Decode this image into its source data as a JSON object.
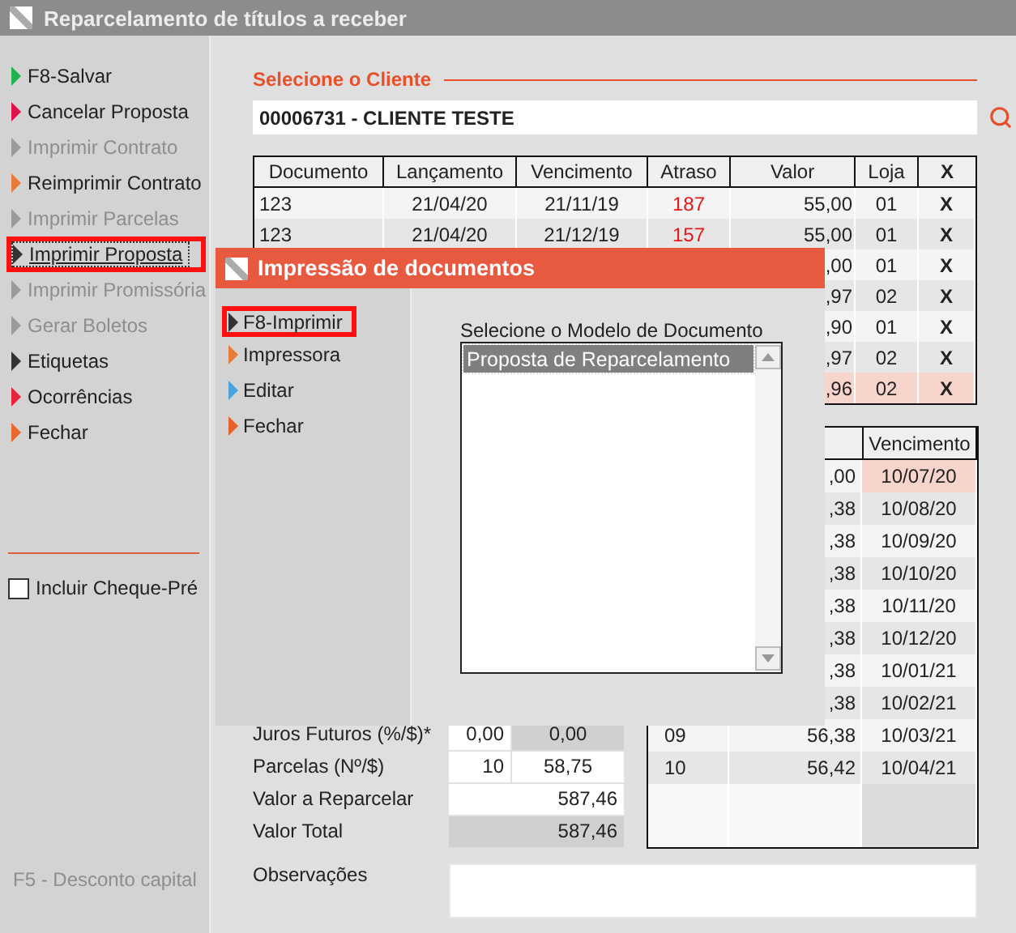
{
  "window": {
    "title": "Reparcelamento de títulos a receber"
  },
  "sidebar": {
    "items": [
      {
        "label": "F8-Salvar",
        "color": "#22b14c",
        "disabled": false,
        "focused": false
      },
      {
        "label": "Cancelar Proposta",
        "color": "#e0134a",
        "disabled": false,
        "focused": false
      },
      {
        "label": "Imprimir Contrato",
        "color": "#9a9a9a",
        "disabled": true,
        "focused": false
      },
      {
        "label": "Reimprimir Contrato",
        "color": "#e87a3a",
        "disabled": false,
        "focused": false
      },
      {
        "label": "Imprimir Parcelas",
        "color": "#9a9a9a",
        "disabled": true,
        "focused": false
      },
      {
        "label": "Imprimir Proposta",
        "color": "#333333",
        "disabled": false,
        "focused": true
      },
      {
        "label": "Imprimir Promissória",
        "color": "#9a9a9a",
        "disabled": true,
        "focused": false
      },
      {
        "label": "Gerar Boletos",
        "color": "#9a9a9a",
        "disabled": true,
        "focused": false
      },
      {
        "label": "Etiquetas",
        "color": "#333333",
        "disabled": false,
        "focused": false
      },
      {
        "label": "Ocorrências",
        "color": "#e8243a",
        "disabled": false,
        "focused": false
      },
      {
        "label": "Fechar",
        "color": "#e86a2a",
        "disabled": false,
        "focused": false
      }
    ],
    "checkbox": {
      "label": "Incluir Cheque-Pré",
      "checked": false
    },
    "footer": "F5 - Desconto capital"
  },
  "client": {
    "label": "Selecione o Cliente",
    "value": "00006731 - CLIENTE TESTE"
  },
  "titles_table": {
    "columns": [
      "Documento",
      "Lançamento",
      "Vencimento",
      "Atraso",
      "Valor",
      "Loja",
      "X"
    ],
    "rows": [
      {
        "document": "123",
        "posted": "21/04/20",
        "due": "21/11/19",
        "delay": "187",
        "value": "55,00",
        "store": "01",
        "remove": "X",
        "highlighted": false
      },
      {
        "document": "123",
        "posted": "21/04/20",
        "due": "21/12/19",
        "delay": "157",
        "value": "55,00",
        "store": "01",
        "remove": "X",
        "highlighted": false
      },
      {
        "value": ",00",
        "store": "01",
        "remove": "X",
        "highlighted": false
      },
      {
        "value": ",97",
        "store": "02",
        "remove": "X",
        "highlighted": false
      },
      {
        "value": ",90",
        "store": "01",
        "remove": "X",
        "highlighted": false
      },
      {
        "value": ",97",
        "store": "02",
        "remove": "X",
        "highlighted": false
      },
      {
        "value": ",96",
        "store": "02",
        "remove": "X",
        "highlighted": true
      }
    ]
  },
  "form": [
    {
      "label": "Juros Futuros (%/$)*",
      "kind": "pair",
      "boxes": [
        {
          "value": "0,00",
          "readonly": false
        },
        {
          "value": "0,00",
          "readonly": true
        }
      ]
    },
    {
      "label": "Parcelas (Nº/$)",
      "kind": "pair",
      "boxes": [
        {
          "value": "10",
          "readonly": false
        },
        {
          "value": "58,75",
          "readonly": false
        }
      ]
    },
    {
      "label": "Valor a Reparcelar",
      "kind": "single",
      "boxes": [
        {
          "value": "587,46",
          "readonly": false
        }
      ]
    },
    {
      "label": "Valor Total",
      "kind": "single",
      "boxes": [
        {
          "value": "587,46",
          "readonly": true
        }
      ]
    }
  ],
  "installments": {
    "column_3": "Vencimento",
    "rows": [
      {
        "value": ",00",
        "due": "10/07/20",
        "highlighted": true
      },
      {
        "value": ",38",
        "due": "10/08/20",
        "highlighted": false
      },
      {
        "value": ",38",
        "due": "10/09/20",
        "highlighted": false
      },
      {
        "value": ",38",
        "due": "10/10/20",
        "highlighted": false
      },
      {
        "value": ",38",
        "due": "10/11/20",
        "highlighted": false
      },
      {
        "value": ",38",
        "due": "10/12/20",
        "highlighted": false
      },
      {
        "value": ",38",
        "due": "10/01/21",
        "highlighted": false
      },
      {
        "value": ",38",
        "due": "10/02/21",
        "highlighted": false
      },
      {
        "number": "09",
        "value": "56,38",
        "due": "10/03/21",
        "highlighted": false
      },
      {
        "number": "10",
        "value": "56,42",
        "due": "10/04/21",
        "highlighted": false
      }
    ]
  },
  "observations": {
    "label": "Observações"
  },
  "dialog": {
    "title": "Impressão de documentos",
    "menu": [
      {
        "label": "F8-Imprimir",
        "color": "#333333",
        "focused": true
      },
      {
        "label": "Impressora",
        "color": "#e87a3a",
        "focused": false
      },
      {
        "label": "Editar",
        "color": "#4aa3df",
        "focused": false
      },
      {
        "label": "Fechar",
        "color": "#e8602a",
        "focused": false
      }
    ],
    "list_label": "Selecione o Modelo de Documento",
    "list_items": [
      {
        "label": "Proposta de Reparcelamento",
        "selected": true
      }
    ]
  }
}
